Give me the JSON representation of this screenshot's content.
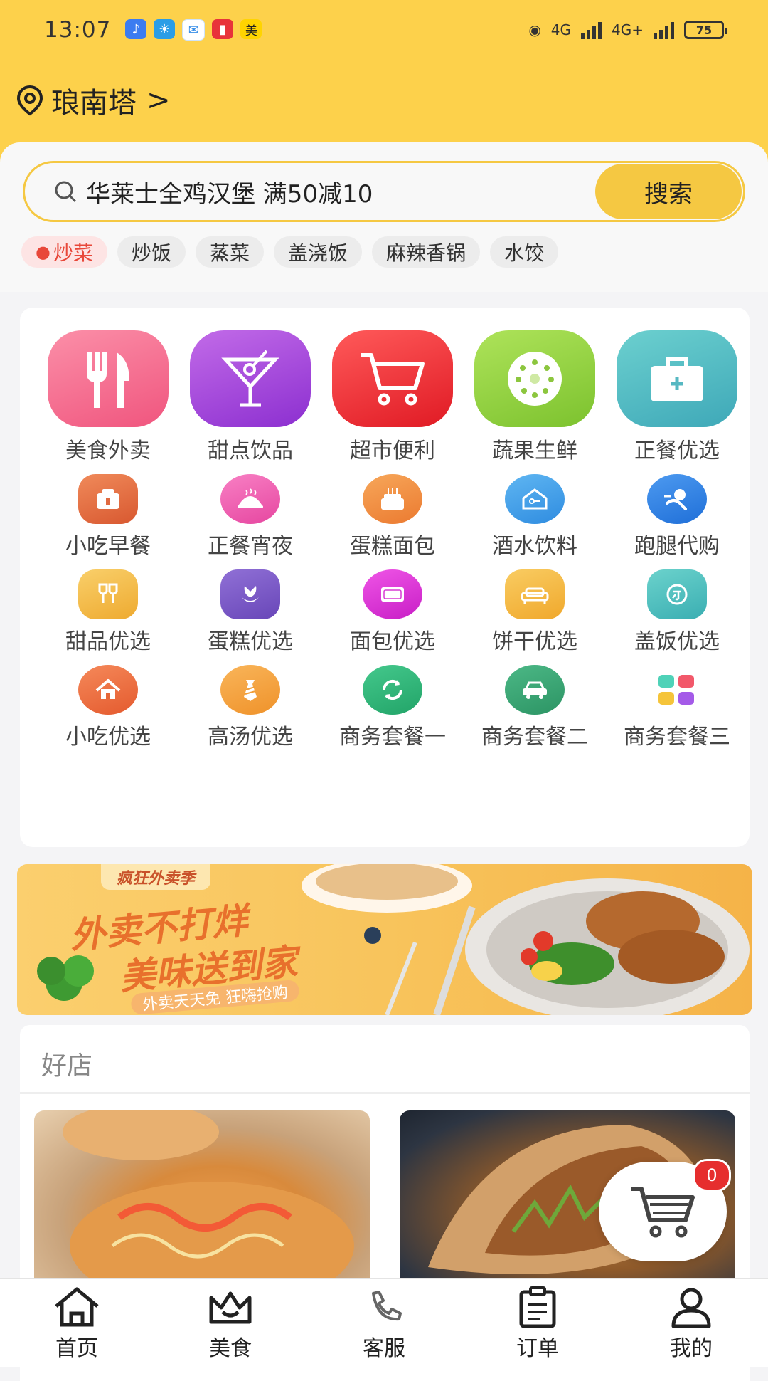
{
  "status_bar": {
    "time": "13:07",
    "notification_icons": [
      "music-icon",
      "weather-icon",
      "chat-icon",
      "book-icon",
      "meituan-icon"
    ],
    "meituan_label": "美",
    "network_1": "4G",
    "network_2": "4G+",
    "battery": "75"
  },
  "location": {
    "name": "琅南塔",
    "chevron": ">"
  },
  "search": {
    "query": "华莱士全鸡汉堡 满50减10",
    "button_label": "搜索"
  },
  "chips": [
    {
      "label": "炒菜",
      "active": true
    },
    {
      "label": "炒饭"
    },
    {
      "label": "蒸菜"
    },
    {
      "label": "盖浇饭"
    },
    {
      "label": "麻辣香锅"
    },
    {
      "label": "水饺"
    }
  ],
  "categories": {
    "big": [
      {
        "label": "美食外卖",
        "icon": "fork-knife-icon",
        "color": "#f46b8f"
      },
      {
        "label": "甜点饮品",
        "icon": "cocktail-icon",
        "color": "#a13fd8"
      },
      {
        "label": "超市便利",
        "icon": "shopping-cart-icon",
        "color": "#f0262e"
      },
      {
        "label": "蔬果生鲜",
        "icon": "kiwi-icon",
        "color": "#8fcf3a"
      },
      {
        "label": "正餐优选",
        "icon": "briefcase-icon",
        "color": "#4fb9c0"
      }
    ],
    "rows": [
      [
        {
          "label": "小吃早餐",
          "icon": "breakfast-icon",
          "color": "#e0653a"
        },
        {
          "label": "正餐宵夜",
          "icon": "dish-icon",
          "color": "#ee5aa0"
        },
        {
          "label": "蛋糕面包",
          "icon": "cake-icon",
          "color": "#f08a3c"
        },
        {
          "label": "酒水饮料",
          "icon": "house-key-icon",
          "color": "#3b9be6"
        },
        {
          "label": "跑腿代购",
          "icon": "runner-icon",
          "color": "#2a7be0"
        }
      ],
      [
        {
          "label": "甜品优选",
          "icon": "cheers-icon",
          "color": "#f3b33a"
        },
        {
          "label": "蛋糕优选",
          "icon": "tulip-icon",
          "color": "#7a56c4"
        },
        {
          "label": "面包优选",
          "icon": "coupon-icon",
          "color": "#e030d8"
        },
        {
          "label": "饼干优选",
          "icon": "sofa-icon",
          "color": "#f6b53a"
        },
        {
          "label": "盖饭优选",
          "icon": "circle-tag-icon",
          "color": "#4fbfbf"
        }
      ],
      [
        {
          "label": "小吃优选",
          "icon": "home-icon",
          "color": "#ee6a3c"
        },
        {
          "label": "高汤优选",
          "icon": "tie-icon",
          "color": "#f5a13a"
        },
        {
          "label": "商务套餐一",
          "icon": "refresh-icon",
          "color": "#2fb57a"
        },
        {
          "label": "商务套餐二",
          "icon": "car-icon",
          "color": "#3aa374"
        },
        {
          "label": "商务套餐三",
          "icon": "apps-grid-icon",
          "color": "#f0b030"
        }
      ]
    ]
  },
  "banner": {
    "tag": "疯狂外卖季",
    "line1": "外卖不打烊",
    "line2": "美味送到家",
    "subtitle": "外卖天天免 狂嗨抢购"
  },
  "shops": {
    "title": "好店"
  },
  "cart": {
    "badge": "0"
  },
  "bottom_nav": [
    {
      "label": "首页",
      "icon": "home-outline-icon"
    },
    {
      "label": "美食",
      "icon": "crown-icon"
    },
    {
      "label": "客服",
      "icon": "phone-icon"
    },
    {
      "label": "订单",
      "icon": "clipboard-icon"
    },
    {
      "label": "我的",
      "icon": "user-icon"
    }
  ]
}
